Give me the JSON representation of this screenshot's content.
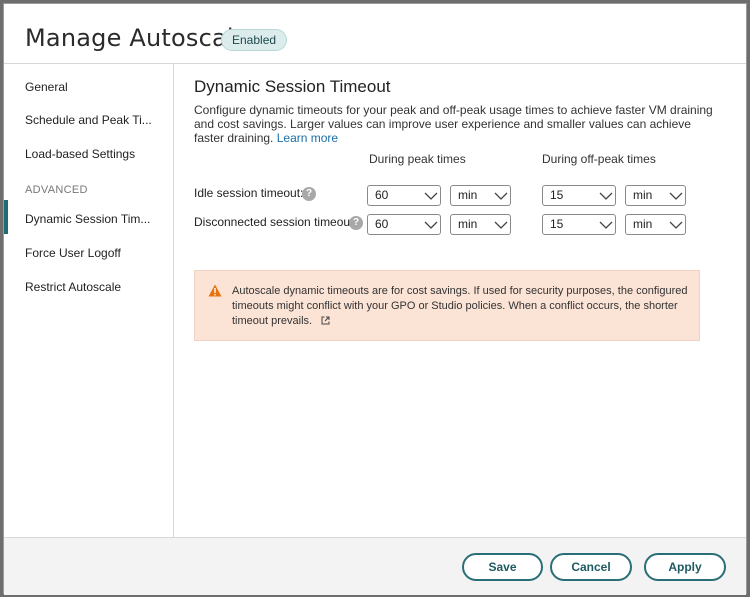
{
  "header": {
    "title": "Manage Autoscale",
    "status_badge": "Enabled"
  },
  "sidebar": {
    "items": [
      {
        "label": "General"
      },
      {
        "label": "Schedule and Peak Ti..."
      },
      {
        "label": "Load-based Settings"
      }
    ],
    "section_label": "ADVANCED",
    "advanced_items": [
      {
        "label": "Dynamic Session Tim...",
        "active": true
      },
      {
        "label": "Force User Logoff"
      },
      {
        "label": "Restrict Autoscale"
      }
    ]
  },
  "main": {
    "title": "Dynamic Session Timeout",
    "description": "Configure dynamic timeouts for your peak and off-peak usage times to achieve faster VM draining and cost savings. Larger values can improve user experience and smaller values can achieve faster draining.",
    "learn_more": "Learn more",
    "col_peak": "During peak times",
    "col_offpeak": "During off-peak times",
    "rows": [
      {
        "label": "Idle session timeout:",
        "peak_value": "60",
        "peak_unit": "min",
        "offpeak_value": "15",
        "offpeak_unit": "min"
      },
      {
        "label": "Disconnected session timeout:",
        "peak_value": "60",
        "peak_unit": "min",
        "offpeak_value": "15",
        "offpeak_unit": "min"
      }
    ],
    "help_glyph": "?",
    "warning_text": "Autoscale dynamic timeouts are for cost savings. If used for security purposes, the configured timeouts might conflict with your GPO or Studio policies. When a conflict occurs, the shorter timeout prevails.",
    "warning_icon": "warning-triangle-icon",
    "external_link_icon": "external-link-icon"
  },
  "footer": {
    "save_label": "Save",
    "cancel_label": "Cancel",
    "apply_label": "Apply"
  },
  "colors": {
    "accent": "#1f6c73",
    "warning_bg": "#fbe3d6",
    "warning_icon": "#e8730c",
    "link": "#1a6fa8"
  }
}
